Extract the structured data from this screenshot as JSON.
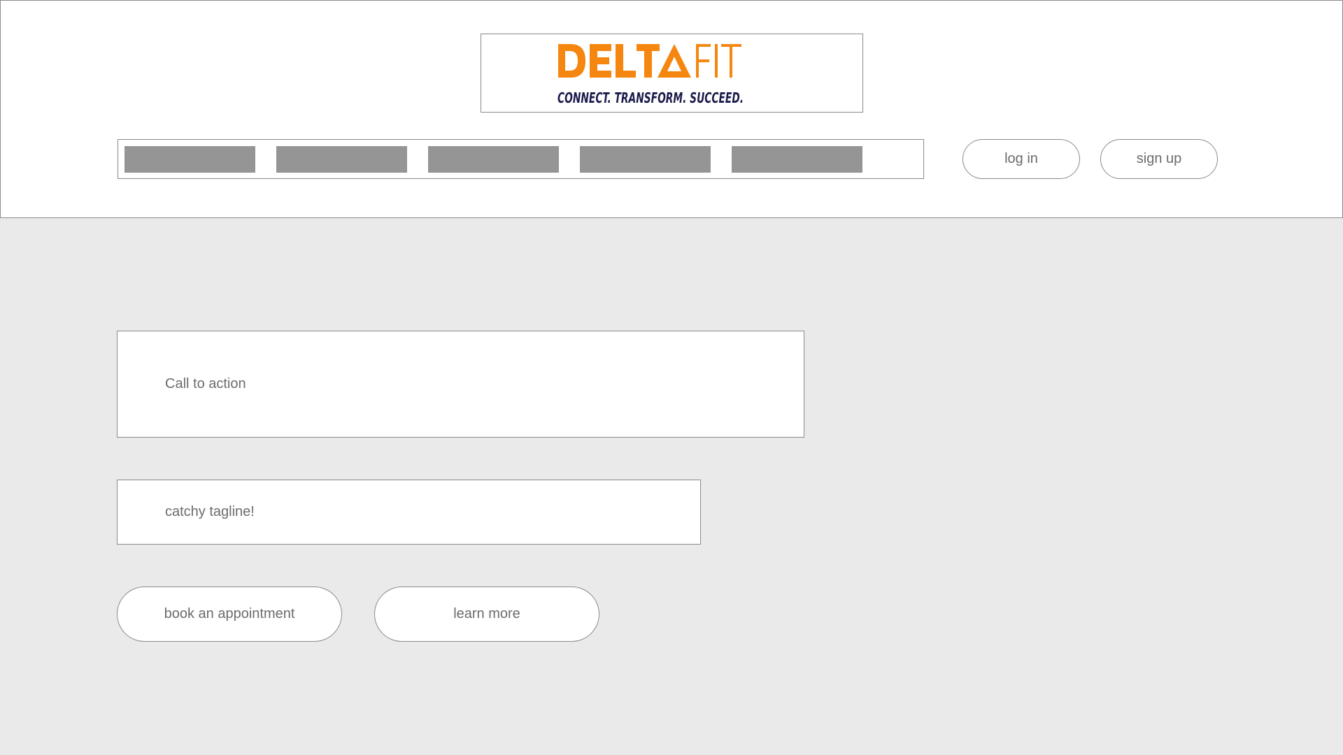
{
  "logo": {
    "name_part1": "DELTA",
    "name_part2": "FIT",
    "slogan": "CONNECT. TRANSFORM. SUCCEED.",
    "brand_color": "#f5860f",
    "slogan_color": "#1a1a4a"
  },
  "nav": {
    "items": [
      "",
      "",
      "",
      "",
      ""
    ],
    "placeholder_color": "#959595"
  },
  "auth": {
    "login_label": "log in",
    "signup_label": "sign up"
  },
  "hero": {
    "cta_text": "Call to action",
    "tagline_text": "catchy tagline!",
    "book_label": "book an appointment",
    "learn_label": "learn more"
  },
  "colors": {
    "page_background": "#eaeaea",
    "header_background": "#ffffff",
    "border": "#8a8a8a"
  }
}
